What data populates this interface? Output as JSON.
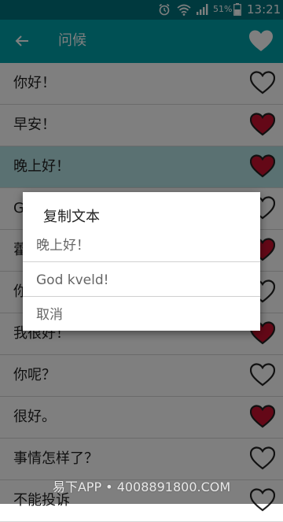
{
  "status_bar": {
    "battery_percent": "51%",
    "time": "13:21"
  },
  "toolbar": {
    "title": "问候"
  },
  "phrases": [
    {
      "text": "你好！",
      "favorite": false
    },
    {
      "text": "早安！",
      "favorite": true
    },
    {
      "text": "晚上好！",
      "favorite": true
    },
    {
      "text": "G",
      "favorite": false
    },
    {
      "text": "藿",
      "favorite": true
    },
    {
      "text": "你",
      "favorite": false
    },
    {
      "text": "我很好！",
      "favorite": true
    },
    {
      "text": "你呢？",
      "favorite": false
    },
    {
      "text": "很好。",
      "favorite": true
    },
    {
      "text": "事情怎样了？",
      "favorite": false
    },
    {
      "text": "不能投诉",
      "favorite": false
    }
  ],
  "dialog": {
    "title": "复制文本",
    "options": [
      "晚上好！",
      "God kveld!",
      "取消"
    ]
  },
  "watermark": "易下APP • 4008891800.COM",
  "colors": {
    "status_bar": "#00737c",
    "toolbar": "#00a0a8",
    "heart_red": "#c8102e",
    "selected_row": "#b5e2e5"
  }
}
